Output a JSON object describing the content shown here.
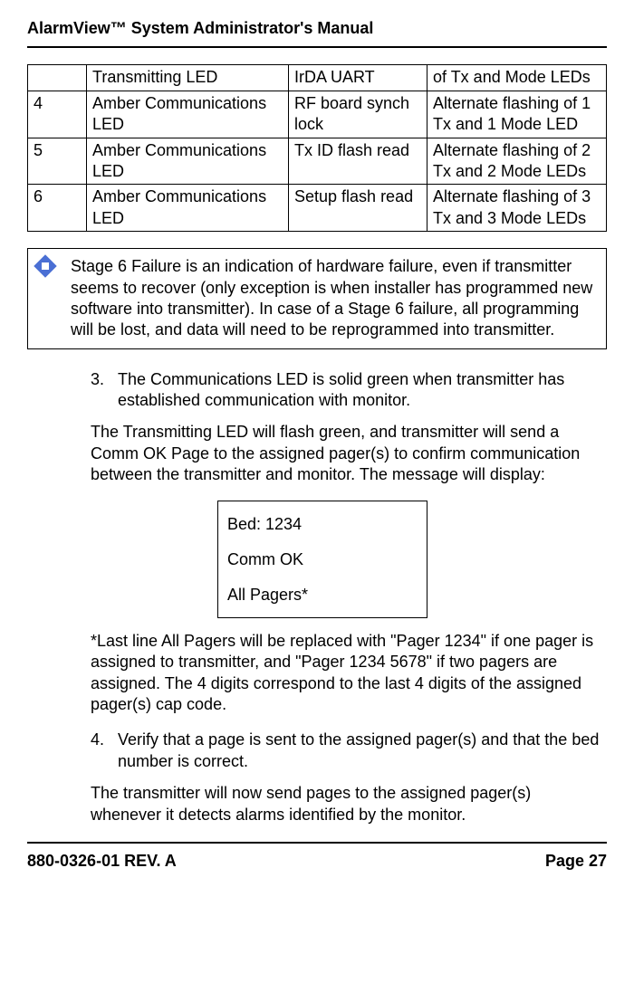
{
  "header": "AlarmView™ System Administrator's Manual",
  "table": {
    "rows": [
      [
        "",
        "Transmitting LED",
        "IrDA UART",
        "of Tx and Mode LEDs"
      ],
      [
        "4",
        "Amber Communications LED",
        "RF board synch lock",
        "Alternate flashing of 1 Tx and 1 Mode LED"
      ],
      [
        "5",
        "Amber Communications LED",
        "Tx ID flash read",
        "Alternate flashing of 2 Tx and 2 Mode LEDs"
      ],
      [
        "6",
        "Amber Communications LED",
        "Setup flash read",
        "Alternate flashing of 3 Tx and 3 Mode LEDs"
      ]
    ]
  },
  "note": "Stage 6 Failure is an indication of hardware failure, even if transmitter seems to recover (only exception is when installer has programmed new software into transmitter). In case of a Stage 6 failure, all programming will be lost, and data will need to be reprogrammed into transmitter.",
  "step3_num": "3.",
  "step3_a": "The Communications LED is solid green when transmitter has established communication with monitor.",
  "step3_b": "The Transmitting LED will flash green, and transmitter will send a Comm OK Page to the assigned pager(s) to confirm communication between the transmitter and monitor. The message will display:",
  "msgbox": {
    "line1": "Bed: 1234",
    "line2": "Comm OK",
    "line3": "All Pagers*"
  },
  "after_msg": "*Last line All Pagers will be replaced with \"Pager 1234\" if one pager is assigned to transmitter, and \"Pager 1234 5678\" if two pagers are assigned.  The 4 digits correspond to the last 4 digits of the assigned pager(s) cap code.",
  "step4_num": "4.",
  "step4": "Verify that a page is sent to the assigned pager(s) and that the bed number is correct.",
  "closing": "The transmitter will now send pages to the assigned pager(s) whenever it detects alarms identified by the monitor.",
  "footer_left": "880-0326-01 REV. A",
  "footer_right": "Page 27"
}
